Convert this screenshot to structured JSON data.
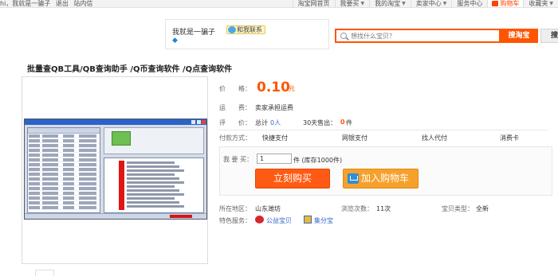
{
  "topbar": {
    "left": [
      "hi，我就是一骗子",
      "退出",
      "站内信"
    ],
    "right": [
      {
        "label": "淘宝网首页",
        "arrow": false
      },
      {
        "label": "我要买",
        "arrow": true
      },
      {
        "label": "我的淘宝",
        "arrow": true
      },
      {
        "label": "卖家中心",
        "arrow": true
      },
      {
        "label": "服务中心",
        "arrow": false
      }
    ],
    "cart": "购物车",
    "favorites": "收藏夹"
  },
  "seller": {
    "name": "我就是一骗子",
    "contact": "和我联系"
  },
  "search": {
    "placeholder": "想找什么宝贝？",
    "button": "搜淘宝",
    "button2": "搜"
  },
  "product": {
    "title": "批量查QB工具/QB查询助手 /Q币查询软件 /Q点查询软件",
    "price_label": "价　　格：",
    "price": "0.10",
    "price_unit": "元",
    "shipping_label": "运　　费：",
    "shipping_value": "卖家承担运费",
    "rating_label": "评　　价：",
    "rating_total": "总计",
    "rating_count": "0人",
    "sold_label": "30天售出：",
    "sold_count": "0",
    "sold_unit": "件",
    "payment_label": "付款方式：",
    "payment_methods": [
      "快捷支付",
      "网银支付",
      "找人代付",
      "消费卡"
    ],
    "buy_label": "我 要 买：",
    "quantity": "1",
    "stock_text": "件 (库存1000件)",
    "buy_button": "立刻购买",
    "cart_button": "加入购物车",
    "location_label": "所在地区：",
    "location_value": "山东潍坊",
    "views_label": "浏览次数：",
    "views_value": "11次",
    "condition_label": "宝贝类型：",
    "condition_value": "全新",
    "services_label": "特色服务：",
    "services": [
      "公益宝贝",
      "集分宝"
    ]
  }
}
